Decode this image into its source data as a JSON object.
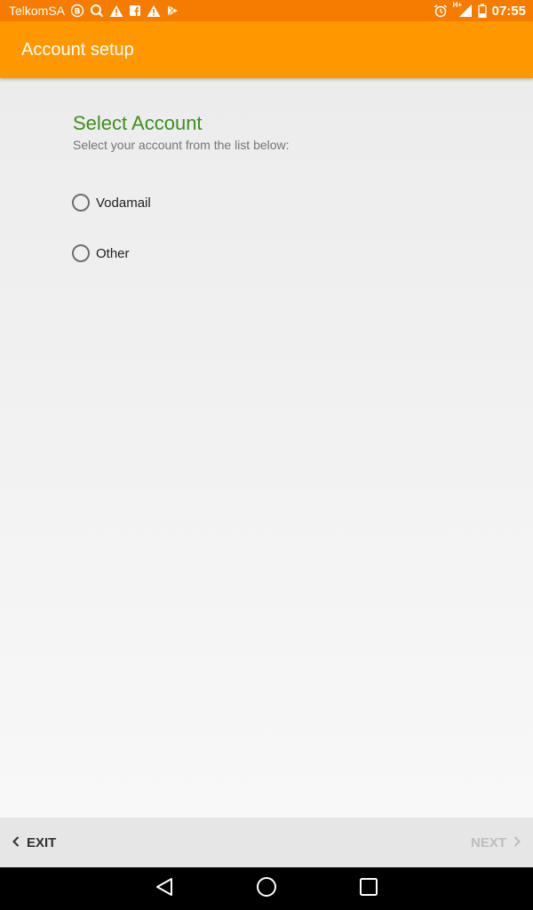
{
  "status_bar": {
    "carrier": "TelkomSA",
    "network_type": "H+",
    "time": "07:55",
    "icons": [
      "b-circle-icon",
      "search-icon",
      "warning-icon",
      "facebook-icon",
      "warning-icon",
      "play-store-icon",
      "alarm-icon",
      "signal-icon",
      "battery-icon"
    ]
  },
  "app_bar": {
    "title": "Account setup"
  },
  "main": {
    "title": "Select Account",
    "subtitle": "Select your account from the list below:",
    "options": [
      {
        "label": "Vodamail",
        "selected": false
      },
      {
        "label": "Other",
        "selected": false
      }
    ]
  },
  "footer": {
    "exit_label": "EXIT",
    "next_label": "NEXT",
    "next_enabled": false
  },
  "nav_bar": {
    "buttons": [
      "back-icon",
      "home-icon",
      "recents-icon"
    ]
  },
  "colors": {
    "status_bar": "#f57c00",
    "app_bar": "#ff9800",
    "title": "#3e8e1f",
    "disabled": "#bdbdbd"
  }
}
